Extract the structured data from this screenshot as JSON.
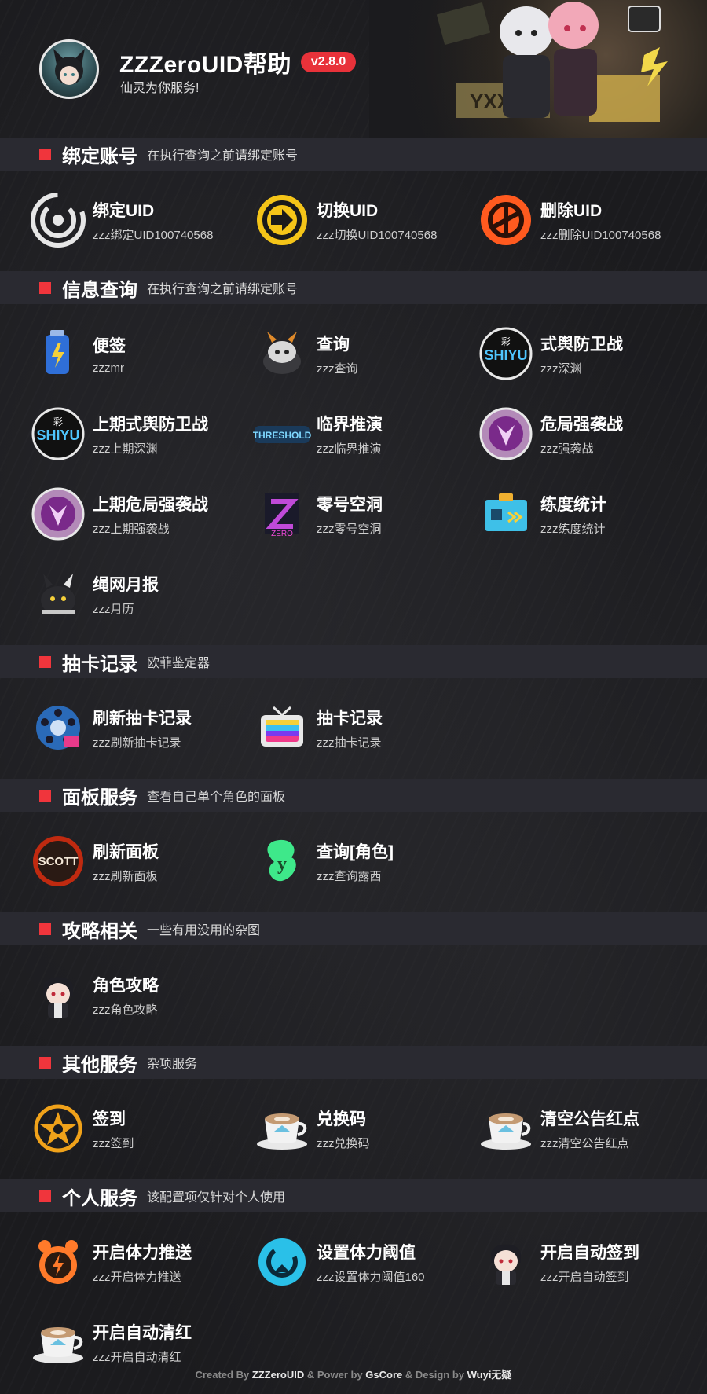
{
  "header": {
    "title": "ZZZeroUID帮助",
    "version": "v2.8.0",
    "subtitle": "仙灵为你服务!"
  },
  "colors": {
    "accent": "#f0353c",
    "section_bg": "#2a2a31",
    "page_bg": "#1c1c1f"
  },
  "sections": [
    {
      "title": "绑定账号",
      "desc": "在执行查询之前请绑定账号",
      "items": [
        {
          "name": "绑定UID",
          "cmd": "zzz绑定UID100740568",
          "icon": "bind-uid-icon"
        },
        {
          "name": "切换UID",
          "cmd": "zzz切换UID100740568",
          "icon": "switch-uid-icon"
        },
        {
          "name": "删除UID",
          "cmd": "zzz删除UID100740568",
          "icon": "delete-uid-icon"
        }
      ]
    },
    {
      "title": "信息查询",
      "desc": "在执行查询之前请绑定账号",
      "items": [
        {
          "name": "便签",
          "cmd": "zzzmr",
          "icon": "battery-icon"
        },
        {
          "name": "查询",
          "cmd": "zzz查询",
          "icon": "bangboo-icon"
        },
        {
          "name": "式舆防卫战",
          "cmd": "zzz深渊",
          "icon": "shiyu-icon"
        },
        {
          "name": "上期式舆防卫战",
          "cmd": "zzz上期深渊",
          "icon": "shiyu-icon"
        },
        {
          "name": "临界推演",
          "cmd": "zzz临界推演",
          "icon": "threshold-icon"
        },
        {
          "name": "危局强袭战",
          "cmd": "zzz强袭战",
          "icon": "assault-icon"
        },
        {
          "name": "上期危局强袭战",
          "cmd": "zzz上期强袭战",
          "icon": "assault-icon"
        },
        {
          "name": "零号空洞",
          "cmd": "zzz零号空洞",
          "icon": "hollow-zero-icon"
        },
        {
          "name": "练度统计",
          "cmd": "zzz练度统计",
          "icon": "id-card-icon"
        },
        {
          "name": "绳网月报",
          "cmd": "zzz月历",
          "icon": "eous-icon"
        }
      ]
    },
    {
      "title": "抽卡记录",
      "desc": "欧菲鉴定器",
      "items": [
        {
          "name": "刷新抽卡记录",
          "cmd": "zzz刷新抽卡记录",
          "icon": "film-reel-icon"
        },
        {
          "name": "抽卡记录",
          "cmd": "zzz抽卡记录",
          "icon": "tv-icon"
        }
      ]
    },
    {
      "title": "面板服务",
      "desc": "查看自己单个角色的面板",
      "items": [
        {
          "name": "刷新面板",
          "cmd": "zzz刷新面板",
          "icon": "scott-outpost-icon"
        },
        {
          "name": "查询[角色]",
          "cmd": "zzz查询露西",
          "icon": "character-logo-icon"
        }
      ]
    },
    {
      "title": "攻略相关",
      "desc": "一些有用没用的杂图",
      "items": [
        {
          "name": "角色攻略",
          "cmd": "zzz角色攻略",
          "icon": "chibi-character-icon"
        }
      ]
    },
    {
      "title": "其他服务",
      "desc": "杂项服务",
      "items": [
        {
          "name": "签到",
          "cmd": "zzz签到",
          "icon": "sign-in-badge-icon"
        },
        {
          "name": "兑换码",
          "cmd": "zzz兑换码",
          "icon": "coffee-cup-icon"
        },
        {
          "name": "清空公告红点",
          "cmd": "zzz清空公告红点",
          "icon": "coffee-cup-icon"
        }
      ]
    },
    {
      "title": "个人服务",
      "desc": "该配置项仅针对个人使用",
      "items": [
        {
          "name": "开启体力推送",
          "cmd": "zzz开启体力推送",
          "icon": "energy-alarm-icon"
        },
        {
          "name": "设置体力阈值",
          "cmd": "zzz设置体力阈值160",
          "icon": "refresh-circle-icon"
        },
        {
          "name": "开启自动签到",
          "cmd": "zzz开启自动签到",
          "icon": "chibi-character-icon"
        },
        {
          "name": "开启自动清红",
          "cmd": "zzz开启自动清红",
          "icon": "coffee-cup-icon"
        }
      ]
    }
  ],
  "footer": {
    "prefix": "Created By ",
    "author": "ZZZeroUID",
    "mid1": " & Power by ",
    "power": "GsCore",
    "mid2": " & Design by ",
    "designer": "Wuyi无疑"
  }
}
